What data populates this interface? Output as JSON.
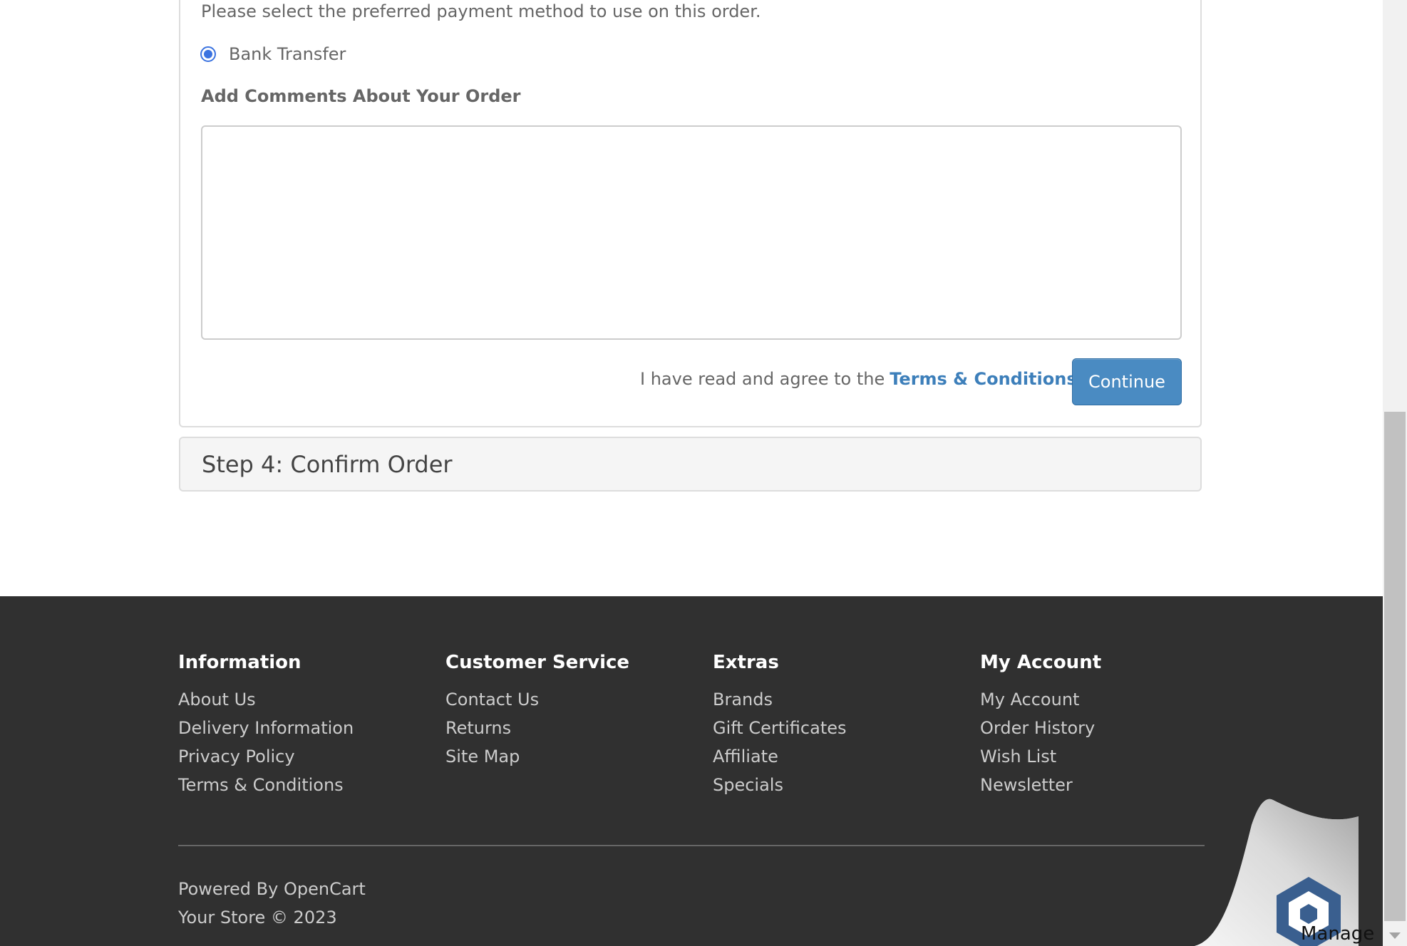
{
  "payment": {
    "intro": "Please select the preferred payment method to use on this order.",
    "method_label": "Bank Transfer"
  },
  "comments": {
    "heading": "Add Comments About Your Order",
    "value": ""
  },
  "agree": {
    "text": "I have read and agree to the",
    "link": "Terms & Conditions",
    "checked": true
  },
  "continue_label": "Continue",
  "step4_title": "Step 4: Confirm Order",
  "footer": {
    "information": {
      "heading": "Information",
      "links": [
        "About Us",
        "Delivery Information",
        "Privacy Policy",
        "Terms & Conditions"
      ]
    },
    "customer_service": {
      "heading": "Customer Service",
      "links": [
        "Contact Us",
        "Returns",
        "Site Map"
      ]
    },
    "extras": {
      "heading": "Extras",
      "links": [
        "Brands",
        "Gift Certificates",
        "Affiliate",
        "Specials"
      ]
    },
    "my_account": {
      "heading": "My Account",
      "links": [
        "My Account",
        "Order History",
        "Wish List",
        "Newsletter"
      ]
    },
    "powered_by": "Powered By",
    "opencart": "OpenCart",
    "copyright": "Your Store © 2023"
  },
  "manage_label": "Manage",
  "colors": {
    "accent": "#3d7fba",
    "button": "#4a8bc2",
    "footer_bg": "#303030",
    "radio": "#3b73e0"
  }
}
